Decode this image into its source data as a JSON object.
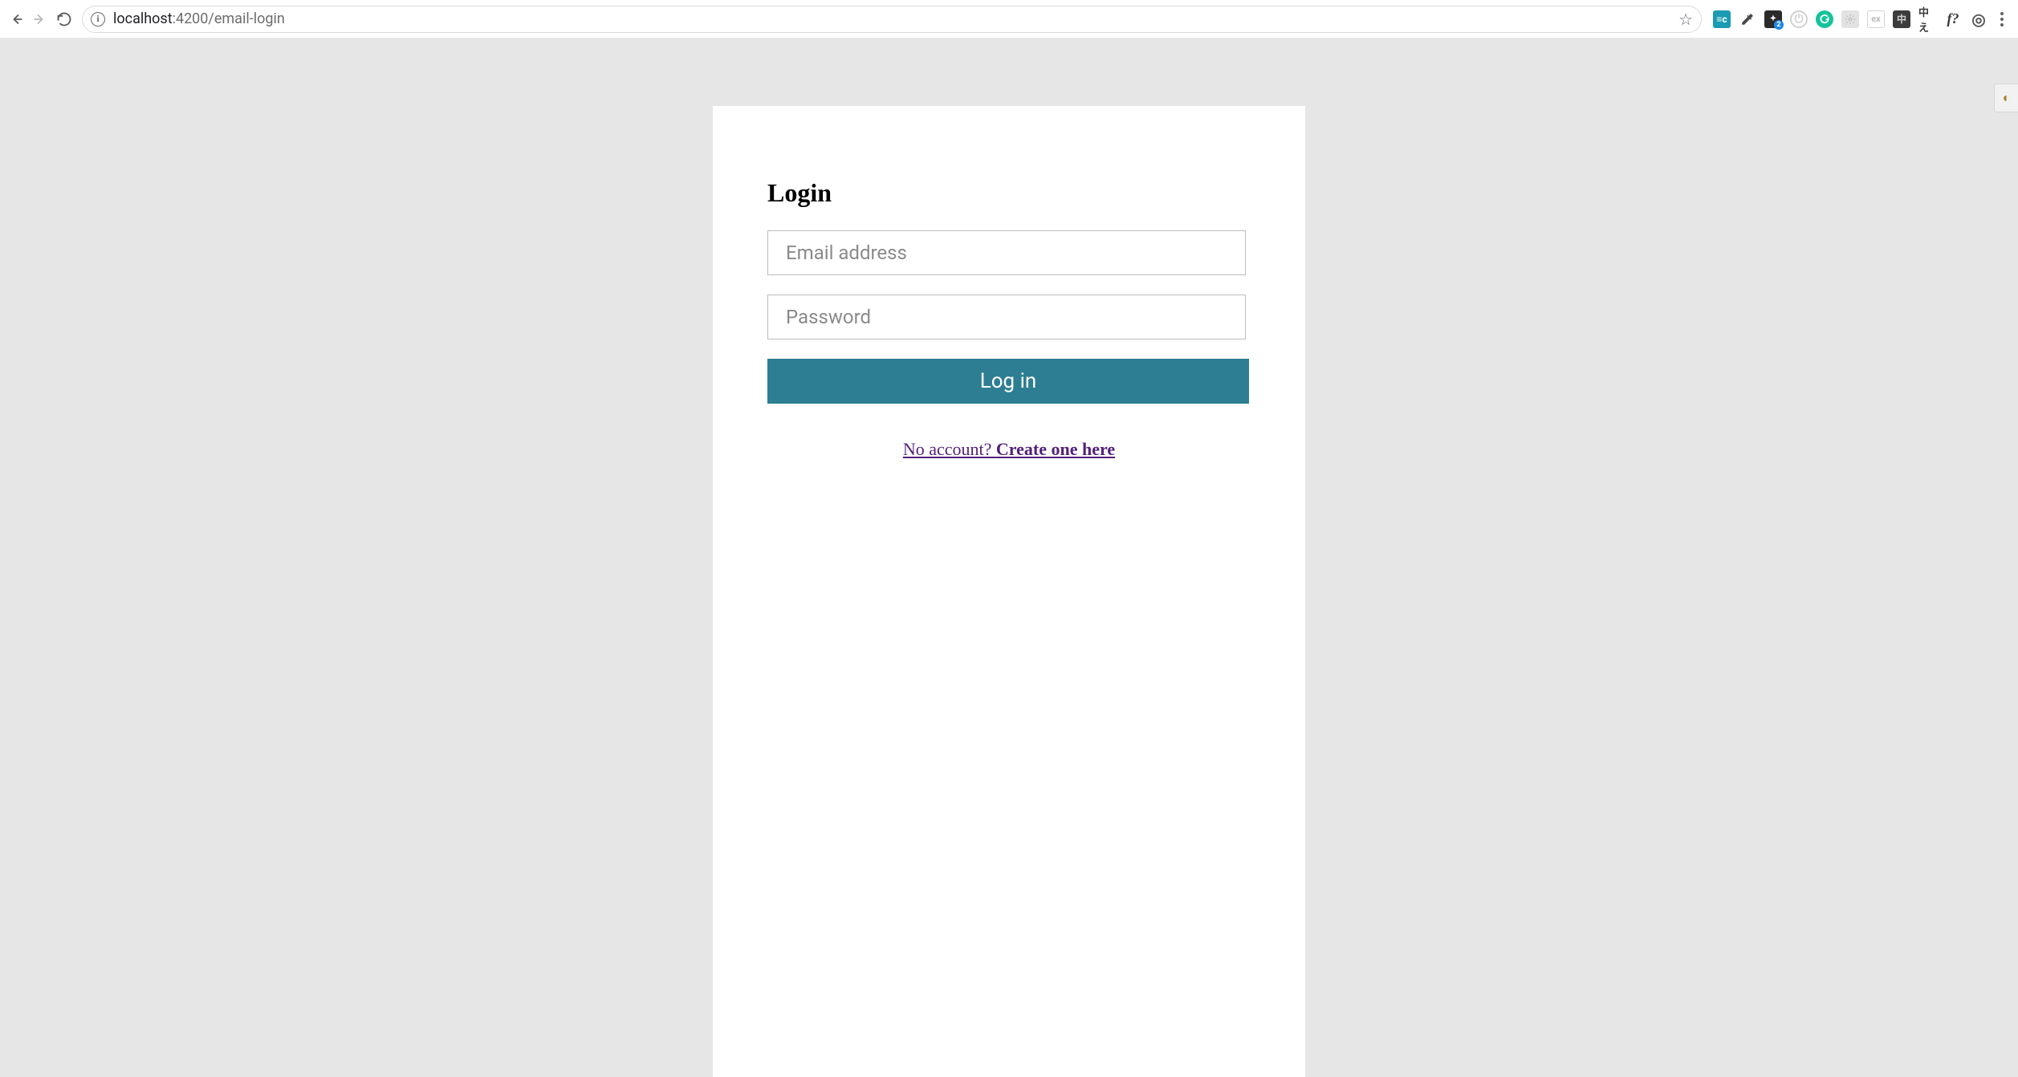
{
  "browser": {
    "url_host": "localhost",
    "url_rest": ":4200/email-login",
    "info_glyph": "i",
    "star_glyph": "☆"
  },
  "page": {
    "title": "Login",
    "email_placeholder": "Email address",
    "password_placeholder": "Password",
    "login_button": "Log in",
    "signup_prefix": "No account? ",
    "signup_cta": "Create one here"
  },
  "ext_labels": {
    "teal": "≡c",
    "dark": "✦",
    "ex": "ex",
    "dark_sq": "中",
    "cjk": "中え",
    "fq": "f?",
    "swirl": "◎"
  }
}
